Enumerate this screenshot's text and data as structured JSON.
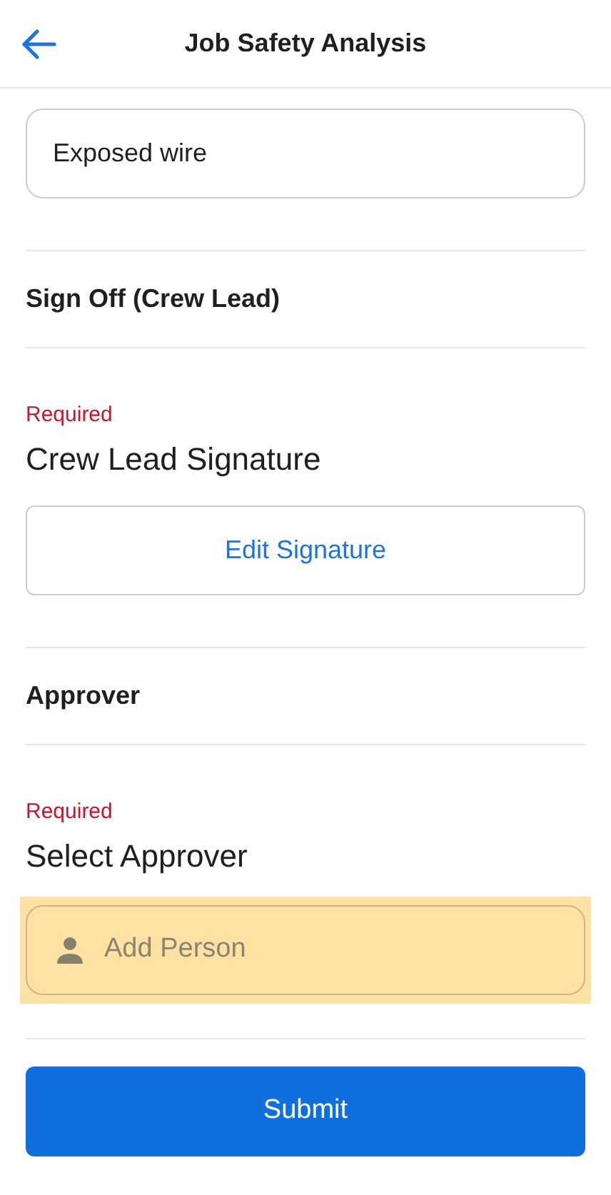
{
  "header": {
    "title": "Job Safety Analysis"
  },
  "items": [
    {
      "kind": "text_input",
      "value": "Exposed wire"
    },
    {
      "kind": "heading",
      "text": "Sign Off (Crew Lead)"
    },
    {
      "kind": "signature",
      "required": true,
      "required_text": "Required",
      "label": "Crew Lead Signature",
      "button": "Edit Signature"
    },
    {
      "kind": "heading",
      "text": "Approver"
    },
    {
      "kind": "person",
      "required": true,
      "required_text": "Required",
      "label": "Select Approver",
      "placeholder": "Add Person",
      "highlighted": true
    }
  ],
  "submit": {
    "label": "Submit"
  }
}
